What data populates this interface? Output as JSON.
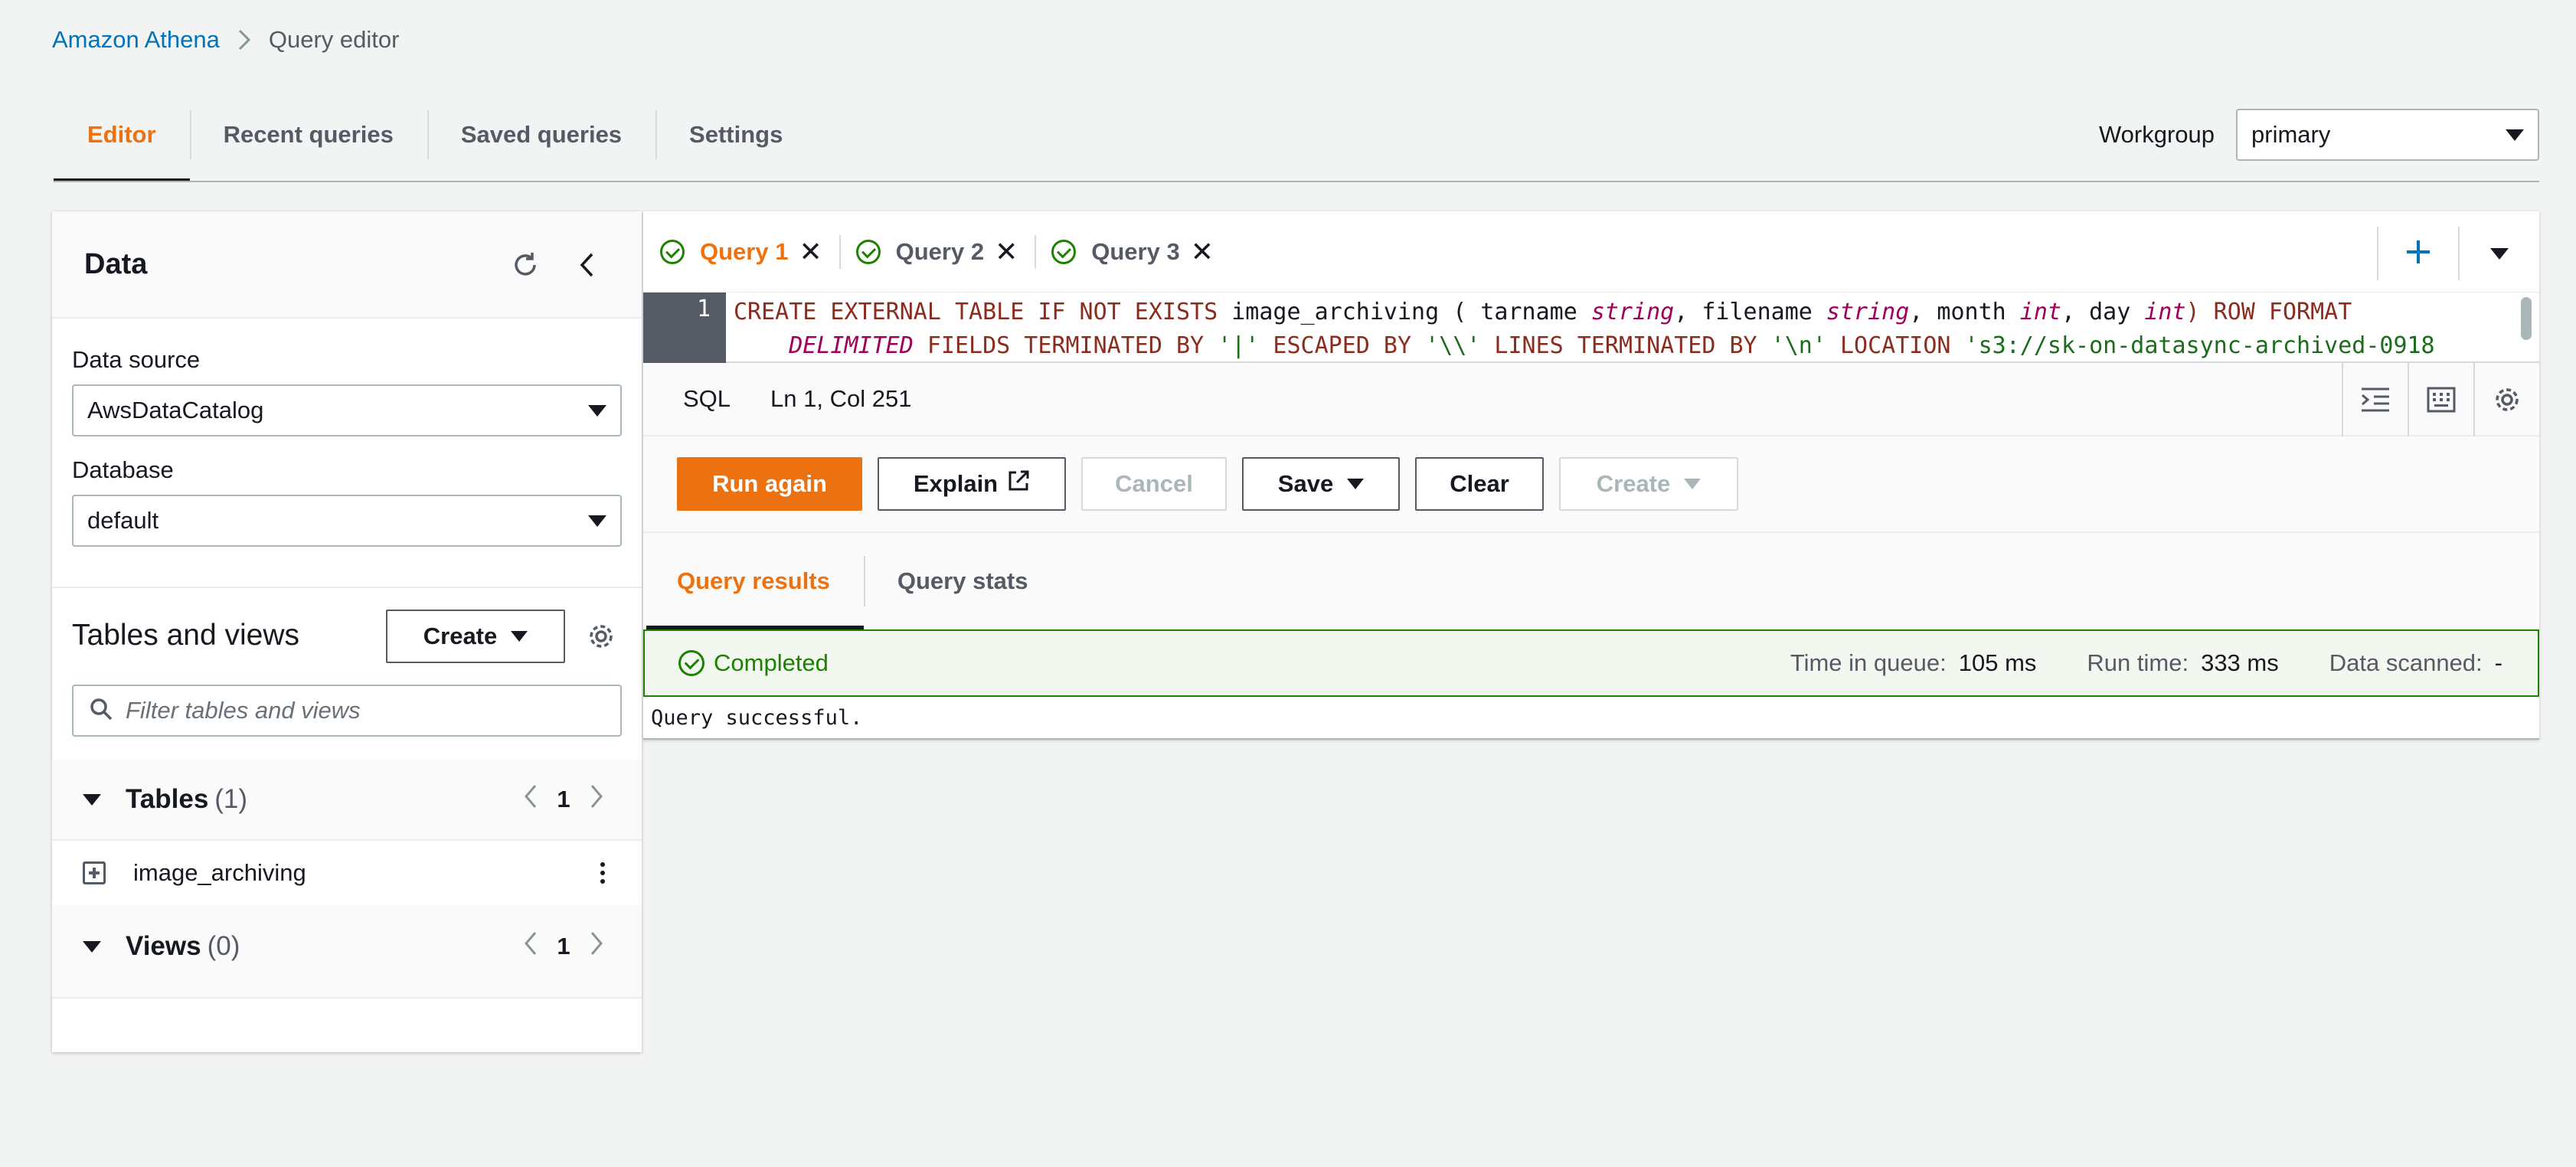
{
  "breadcrumb": {
    "root": "Amazon Athena",
    "current": "Query editor"
  },
  "top_tabs": [
    "Editor",
    "Recent queries",
    "Saved queries",
    "Settings"
  ],
  "workgroup": {
    "label": "Workgroup",
    "value": "primary"
  },
  "data_panel": {
    "title": "Data",
    "data_source_label": "Data source",
    "data_source_value": "AwsDataCatalog",
    "database_label": "Database",
    "database_value": "default",
    "tables_views_title": "Tables and views",
    "create_label": "Create",
    "filter_placeholder": "Filter tables and views",
    "tables": {
      "label": "Tables",
      "count": "(1)",
      "page": "1",
      "items": [
        "image_archiving"
      ]
    },
    "views": {
      "label": "Views",
      "count": "(0)",
      "page": "1"
    }
  },
  "query_tabs": [
    "Query 1",
    "Query 2",
    "Query 3"
  ],
  "editor": {
    "line_number": "1",
    "line1_parts": [
      "CREATE EXTERNAL TABLE IF NOT EXISTS ",
      "image_archiving ( tarname ",
      "string",
      ", filename ",
      "string",
      ", month ",
      "int",
      ", day ",
      "int",
      ") ROW FORMAT"
    ],
    "line2_parts": [
      "DELIMITED",
      " FIELDS TERMINATED BY ",
      "'|'",
      " ESCAPED BY ",
      "'\\\\'",
      " LINES TERMINATED BY ",
      "'\\n'",
      " LOCATION ",
      "'s3://sk-on-datasync-archived-0918"
    ],
    "language": "SQL",
    "cursor": "Ln 1, Col 251"
  },
  "actions": {
    "run_again": "Run again",
    "explain": "Explain",
    "cancel": "Cancel",
    "save": "Save",
    "clear": "Clear",
    "create": "Create"
  },
  "result_tabs": [
    "Query results",
    "Query stats"
  ],
  "status": {
    "text": "Completed",
    "time_in_queue_label": "Time in queue:",
    "time_in_queue_value": "105 ms",
    "run_time_label": "Run time:",
    "run_time_value": "333 ms",
    "data_scanned_label": "Data scanned:",
    "data_scanned_value": "-"
  },
  "result_message": "Query successful.",
  "colors": {
    "accent": "#ec7211",
    "link": "#0073bb",
    "success": "#1d8102"
  }
}
